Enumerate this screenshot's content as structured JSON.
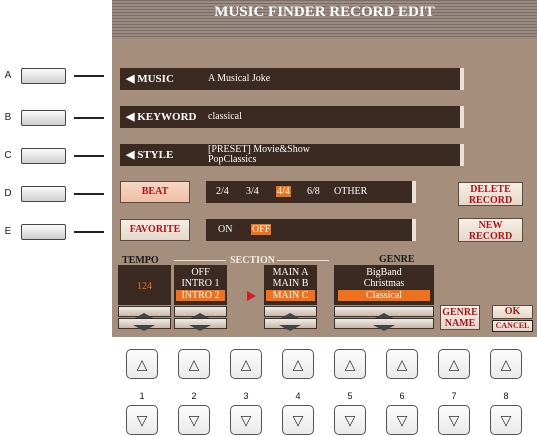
{
  "title": "MUSIC FINDER RECORD EDIT",
  "side_buttons": [
    "A",
    "B",
    "C",
    "D",
    "E"
  ],
  "rows": {
    "music": {
      "label": "MUSIC",
      "value": "A Musical Joke"
    },
    "keyword": {
      "label": "KEYWORD",
      "value": "classical"
    },
    "style": {
      "label": "STYLE",
      "value_line1": "[PRESET]   Movie&Show",
      "value_line2": "PopClassics"
    }
  },
  "beat": {
    "label": "BEAT",
    "options": [
      "2/4",
      "3/4",
      "4/4",
      "6/8",
      "OTHER"
    ],
    "selected": "4/4"
  },
  "favorite": {
    "label": "FAVORITE",
    "options": [
      "ON",
      "OFF"
    ],
    "selected": "OFF"
  },
  "delete_record": {
    "line1": "DELETE",
    "line2": "RECORD"
  },
  "new_record": {
    "line1": "NEW",
    "line2": "RECORD"
  },
  "tempo": {
    "header": "TEMPO",
    "value": "124"
  },
  "section": {
    "header": "SECTION",
    "left_options": [
      "OFF",
      "INTRO 1",
      "INTRO 2"
    ],
    "left_selected": "INTRO 2",
    "right_options": [
      "MAIN A",
      "MAIN B",
      "MAIN C"
    ],
    "right_selected": "MAIN C"
  },
  "genre": {
    "header": "GENRE",
    "options": [
      "BigBand",
      "Christmas",
      "Classical"
    ],
    "selected": "Classical"
  },
  "genre_name": {
    "line1": "GENRE",
    "line2": "NAME"
  },
  "ok": "OK",
  "cancel": "CANCEL",
  "bottom_numbers": [
    "1",
    "2",
    "3",
    "4",
    "5",
    "6",
    "7",
    "8"
  ],
  "up_glyph": "△",
  "down_glyph": "▽",
  "colors": {
    "selected": "#f0711b",
    "label_red": "#b2111b",
    "lcd_bg": "#a58e7c",
    "dark": "#3a2a22"
  }
}
